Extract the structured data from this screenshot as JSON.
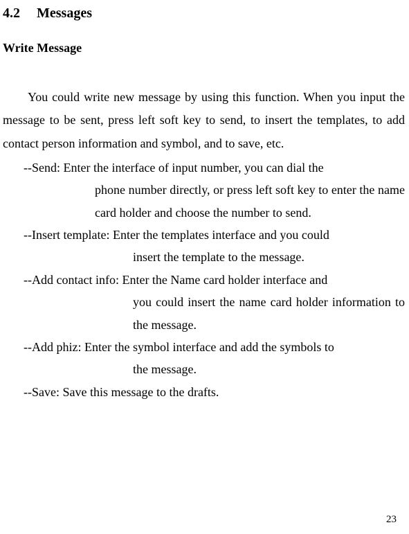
{
  "section": {
    "number": "4.2",
    "title": "Messages"
  },
  "subheading": "Write Message",
  "intro": "You could write new message by using this function. When you input the message to be sent, press left soft key to send, to insert the templates, to add contact person information and symbol, and to save, etc.",
  "items": {
    "send": {
      "first": "--Send: Enter the interface of input number, you can dial the",
      "cont": "phone number directly, or press left soft key to enter the name card holder and choose the number to send."
    },
    "insert": {
      "first": "--Insert template: Enter the templates interface and you could",
      "cont": "insert the template to the message."
    },
    "contact": {
      "first": "--Add contact info: Enter the Name card holder interface and",
      "cont": "you could insert the name card holder information to the message."
    },
    "phiz": {
      "first": "--Add phiz: Enter the symbol interface and add the symbols to",
      "cont": "the message."
    },
    "save": {
      "first": "--Save: Save this message to the drafts."
    }
  },
  "pageNumber": "23"
}
